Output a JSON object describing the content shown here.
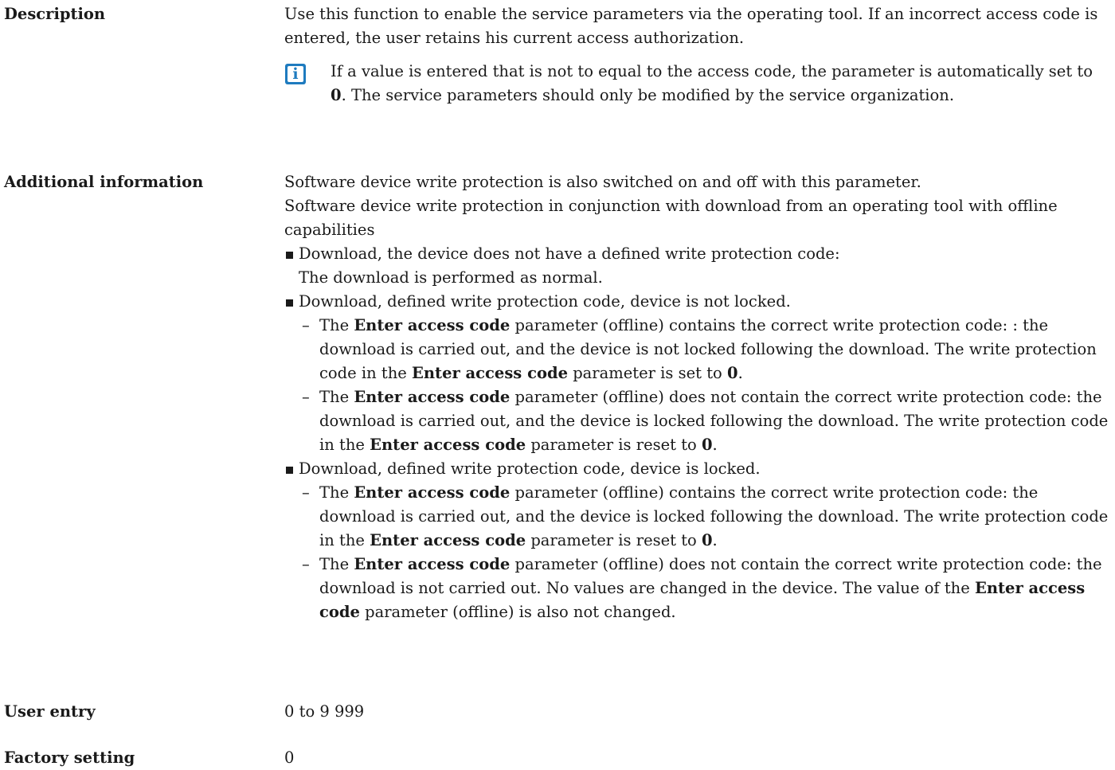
{
  "description": {
    "label": "Description",
    "text": "Use this function to enable the service parameters via the operating tool. If an incorrect access code is entered, the user retains his current access authorization.",
    "note": {
      "icon": "info-icon",
      "icon_glyph": "i",
      "t1": "If a value is entered that is not to equal to the access code, the parameter is automatically set to ",
      "b1": "0",
      "t2": ". The service parameters should only be modified by the service organization."
    }
  },
  "additional": {
    "label": "Additional information",
    "p1": "Software device write protection is also switched on and off with this parameter.",
    "p2": "Software device write protection in conjunction with download from an operating tool with offline capabilities",
    "bullets": [
      {
        "l1": "Download, the device does not have a defined write protection code:",
        "l2": "The download is performed as normal."
      },
      {
        "text": "Download, defined write protection code, device is not locked.",
        "subs": [
          {
            "t1": "The ",
            "b1": "Enter access code",
            "t2": " parameter (offline) contains the correct write protection code: : the download is carried out, and the device is not locked following the download. The write protection code in the ",
            "b2": "Enter access code",
            "t3": " parameter is set to ",
            "b3": "0",
            "t4": "."
          },
          {
            "t1": "The ",
            "b1": "Enter access code",
            "t2": " parameter (offline) does not contain the correct write protection code: the download is carried out, and the device is locked following the download. The write protection code in the ",
            "b2": "Enter access code",
            "t3": " parameter is reset to ",
            "b3": "0",
            "t4": "."
          }
        ]
      },
      {
        "text": "Download, defined write protection code, device is locked.",
        "subs": [
          {
            "t1": "The ",
            "b1": "Enter access code",
            "t2": " parameter (offline) contains the correct write protection code: the download is carried out, and the device is locked following the download. The write protection code in the ",
            "b2": "Enter access code",
            "t3": " parameter is reset to ",
            "b3": "0",
            "t4": "."
          },
          {
            "t1": "The ",
            "b1": "Enter access code",
            "t2": " parameter (offline) does not contain the correct write protection code: the download is not carried out. No values are changed in the device. The value of the ",
            "b2": "Enter access code",
            "t3": " parameter (offline) is also not changed."
          }
        ]
      }
    ]
  },
  "user_entry": {
    "label": "User entry",
    "value": "0 to 9 999"
  },
  "factory_setting": {
    "label": "Factory setting",
    "value": "0"
  }
}
